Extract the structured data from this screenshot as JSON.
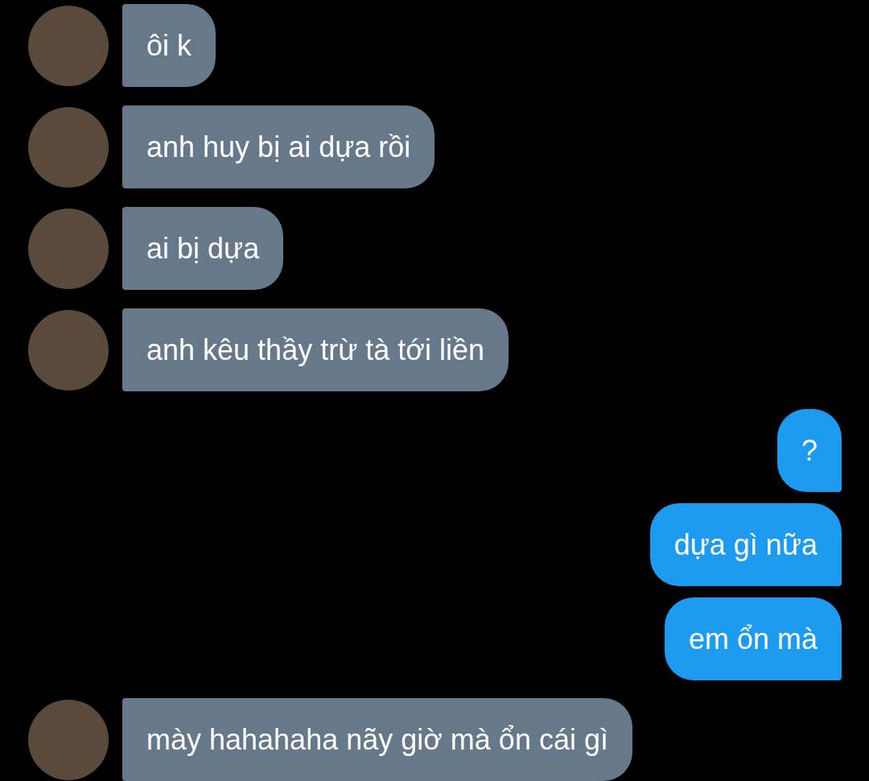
{
  "messages": [
    {
      "kind": "in",
      "text": "ôi k"
    },
    {
      "kind": "in",
      "text": "anh huy bị ai dựa rồi"
    },
    {
      "kind": "in",
      "text": "ai bị dựa"
    },
    {
      "kind": "in",
      "text": "anh kêu thầy trừ tà tới liền"
    },
    {
      "kind": "out",
      "text": "?"
    },
    {
      "kind": "out",
      "text": "dựa gì nữa"
    },
    {
      "kind": "out",
      "text": "em ổn mà"
    },
    {
      "kind": "in",
      "text": "mày hahahaha nãy giờ mà ổn cái gì"
    }
  ]
}
